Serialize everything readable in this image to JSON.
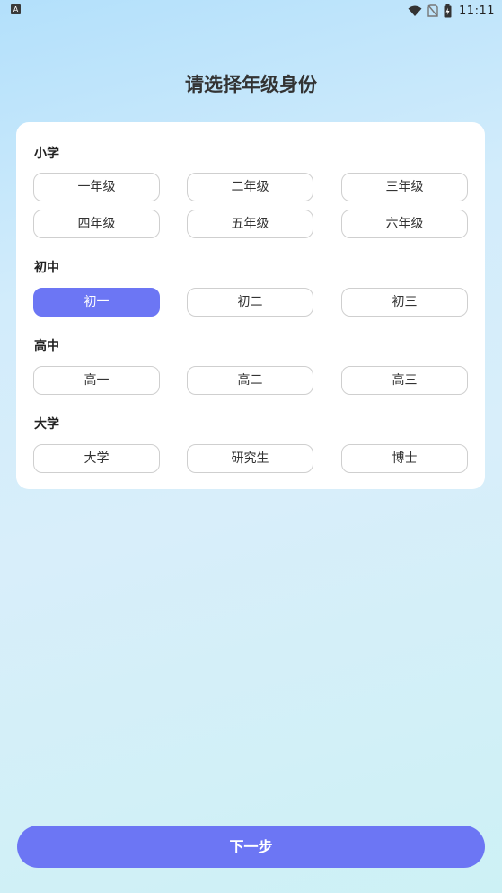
{
  "status_bar": {
    "left_icon_letter": "A",
    "time": "11:11",
    "icons": [
      "wifi-icon",
      "no-sim-icon",
      "battery-charging-icon"
    ]
  },
  "title": "请选择年级身份",
  "sections": [
    {
      "title": "小学",
      "options": [
        "一年级",
        "二年级",
        "三年级",
        "四年级",
        "五年级",
        "六年级"
      ]
    },
    {
      "title": "初中",
      "options": [
        "初一",
        "初二",
        "初三"
      ]
    },
    {
      "title": "高中",
      "options": [
        "高一",
        "高二",
        "高三"
      ]
    },
    {
      "title": "大学",
      "options": [
        "大学",
        "研究生",
        "博士"
      ]
    }
  ],
  "selected": "初一",
  "next_button": "下一步",
  "colors": {
    "accent": "#6c76f4",
    "card": "#ffffff",
    "text": "#333333"
  }
}
